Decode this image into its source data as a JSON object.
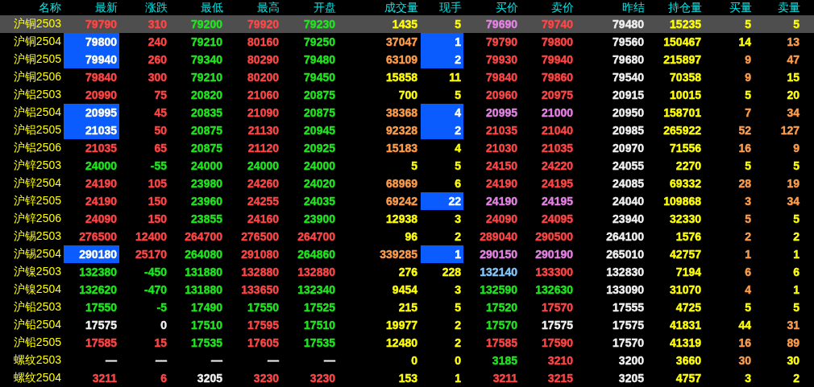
{
  "columns": [
    "名称",
    "最新",
    "涨跌",
    "最低",
    "最高",
    "开盘",
    "成交量",
    "现手",
    "买价",
    "卖价",
    "昨结",
    "持仓量",
    "买量",
    "卖量"
  ],
  "rows": [
    {
      "name": "沪铜2503",
      "selected": true,
      "cells": [
        {
          "text": "79790",
          "color": "#ff4646",
          "flash": false
        },
        {
          "text": "310",
          "color": "#ff4646",
          "flash": false
        },
        {
          "text": "79200",
          "color": "#1ee61e",
          "flash": false
        },
        {
          "text": "79920",
          "color": "#ff4646",
          "flash": false
        },
        {
          "text": "79230",
          "color": "#1ee61e",
          "flash": false
        },
        {
          "text": "1435",
          "color": "#ffff00",
          "flash": false
        },
        {
          "text": "5",
          "color": "#ffff00",
          "flash": false
        },
        {
          "text": "79690",
          "color": "#e682e6",
          "flash": false
        },
        {
          "text": "79740",
          "color": "#ff4646",
          "flash": false
        },
        {
          "text": "79480",
          "color": "#f0f0f0",
          "flash": false
        },
        {
          "text": "15235",
          "color": "#ffff00",
          "flash": false
        },
        {
          "text": "5",
          "color": "#ffff00",
          "flash": false
        },
        {
          "text": "5",
          "color": "#ffff00",
          "flash": false
        }
      ]
    },
    {
      "name": "沪铜2504",
      "selected": false,
      "cells": [
        {
          "text": "79800",
          "color": "#ffffff",
          "flash": true
        },
        {
          "text": "240",
          "color": "#ff4646",
          "flash": false
        },
        {
          "text": "79210",
          "color": "#1ee61e",
          "flash": false
        },
        {
          "text": "80160",
          "color": "#ff4646",
          "flash": false
        },
        {
          "text": "79250",
          "color": "#1ee61e",
          "flash": false
        },
        {
          "text": "37047",
          "color": "#ff9c4a",
          "flash": false
        },
        {
          "text": "1",
          "color": "#ffffff",
          "flash": true
        },
        {
          "text": "79790",
          "color": "#ff4646",
          "flash": false
        },
        {
          "text": "79800",
          "color": "#ff4646",
          "flash": false
        },
        {
          "text": "79560",
          "color": "#f0f0f0",
          "flash": false
        },
        {
          "text": "150467",
          "color": "#ffff00",
          "flash": false
        },
        {
          "text": "14",
          "color": "#ffff00",
          "flash": false
        },
        {
          "text": "13",
          "color": "#ff9c4a",
          "flash": false
        }
      ]
    },
    {
      "name": "沪铜2505",
      "selected": false,
      "cells": [
        {
          "text": "79940",
          "color": "#ffffff",
          "flash": true
        },
        {
          "text": "260",
          "color": "#ff4646",
          "flash": false
        },
        {
          "text": "79340",
          "color": "#1ee61e",
          "flash": false
        },
        {
          "text": "80290",
          "color": "#ff4646",
          "flash": false
        },
        {
          "text": "79480",
          "color": "#1ee61e",
          "flash": false
        },
        {
          "text": "63109",
          "color": "#ff9c4a",
          "flash": false
        },
        {
          "text": "2",
          "color": "#ffffff",
          "flash": true
        },
        {
          "text": "79930",
          "color": "#ff4646",
          "flash": false
        },
        {
          "text": "79940",
          "color": "#ff4646",
          "flash": false
        },
        {
          "text": "79680",
          "color": "#f0f0f0",
          "flash": false
        },
        {
          "text": "215897",
          "color": "#ffff00",
          "flash": false
        },
        {
          "text": "9",
          "color": "#ff9c4a",
          "flash": false
        },
        {
          "text": "47",
          "color": "#ff9c4a",
          "flash": false
        }
      ]
    },
    {
      "name": "沪铜2506",
      "selected": false,
      "cells": [
        {
          "text": "79840",
          "color": "#ff4646",
          "flash": false
        },
        {
          "text": "300",
          "color": "#ff4646",
          "flash": false
        },
        {
          "text": "79210",
          "color": "#1ee61e",
          "flash": false
        },
        {
          "text": "80200",
          "color": "#ff4646",
          "flash": false
        },
        {
          "text": "79450",
          "color": "#1ee61e",
          "flash": false
        },
        {
          "text": "15858",
          "color": "#ffff00",
          "flash": false
        },
        {
          "text": "11",
          "color": "#ffff00",
          "flash": false
        },
        {
          "text": "79840",
          "color": "#ff4646",
          "flash": false
        },
        {
          "text": "79860",
          "color": "#ff4646",
          "flash": false
        },
        {
          "text": "79540",
          "color": "#f0f0f0",
          "flash": false
        },
        {
          "text": "70358",
          "color": "#ffff00",
          "flash": false
        },
        {
          "text": "9",
          "color": "#ff9c4a",
          "flash": false
        },
        {
          "text": "15",
          "color": "#ffff00",
          "flash": false
        }
      ]
    },
    {
      "name": "沪铝2503",
      "selected": false,
      "cells": [
        {
          "text": "20990",
          "color": "#ff4646",
          "flash": false
        },
        {
          "text": "75",
          "color": "#ff4646",
          "flash": false
        },
        {
          "text": "20820",
          "color": "#1ee61e",
          "flash": false
        },
        {
          "text": "21060",
          "color": "#ff4646",
          "flash": false
        },
        {
          "text": "20875",
          "color": "#1ee61e",
          "flash": false
        },
        {
          "text": "700",
          "color": "#ffff00",
          "flash": false
        },
        {
          "text": "5",
          "color": "#ffff00",
          "flash": false
        },
        {
          "text": "20960",
          "color": "#ff4646",
          "flash": false
        },
        {
          "text": "20975",
          "color": "#ff4646",
          "flash": false
        },
        {
          "text": "20915",
          "color": "#f0f0f0",
          "flash": false
        },
        {
          "text": "10015",
          "color": "#ffff00",
          "flash": false
        },
        {
          "text": "5",
          "color": "#ffff00",
          "flash": false
        },
        {
          "text": "20",
          "color": "#ffff00",
          "flash": false
        }
      ]
    },
    {
      "name": "沪铝2504",
      "selected": false,
      "cells": [
        {
          "text": "20995",
          "color": "#ffffff",
          "flash": true
        },
        {
          "text": "45",
          "color": "#ff4646",
          "flash": false
        },
        {
          "text": "20835",
          "color": "#1ee61e",
          "flash": false
        },
        {
          "text": "21090",
          "color": "#ff4646",
          "flash": false
        },
        {
          "text": "20875",
          "color": "#1ee61e",
          "flash": false
        },
        {
          "text": "38368",
          "color": "#ff9c4a",
          "flash": false
        },
        {
          "text": "4",
          "color": "#ffffff",
          "flash": true
        },
        {
          "text": "20995",
          "color": "#e682e6",
          "flash": false
        },
        {
          "text": "21000",
          "color": "#e682e6",
          "flash": false
        },
        {
          "text": "20950",
          "color": "#f0f0f0",
          "flash": false
        },
        {
          "text": "158701",
          "color": "#ffff00",
          "flash": false
        },
        {
          "text": "7",
          "color": "#ff9c4a",
          "flash": false
        },
        {
          "text": "34",
          "color": "#ff9c4a",
          "flash": false
        }
      ]
    },
    {
      "name": "沪铝2505",
      "selected": false,
      "cells": [
        {
          "text": "21035",
          "color": "#ffffff",
          "flash": true
        },
        {
          "text": "50",
          "color": "#ff4646",
          "flash": false
        },
        {
          "text": "20875",
          "color": "#1ee61e",
          "flash": false
        },
        {
          "text": "21130",
          "color": "#ff4646",
          "flash": false
        },
        {
          "text": "20945",
          "color": "#1ee61e",
          "flash": false
        },
        {
          "text": "92328",
          "color": "#ff9c4a",
          "flash": false
        },
        {
          "text": "2",
          "color": "#ffffff",
          "flash": true
        },
        {
          "text": "21035",
          "color": "#ff4646",
          "flash": false
        },
        {
          "text": "21040",
          "color": "#ff4646",
          "flash": false
        },
        {
          "text": "20985",
          "color": "#f0f0f0",
          "flash": false
        },
        {
          "text": "265922",
          "color": "#ffff00",
          "flash": false
        },
        {
          "text": "52",
          "color": "#ff9c4a",
          "flash": false
        },
        {
          "text": "127",
          "color": "#ff9c4a",
          "flash": false
        }
      ]
    },
    {
      "name": "沪铝2506",
      "selected": false,
      "cells": [
        {
          "text": "21035",
          "color": "#ff4646",
          "flash": false
        },
        {
          "text": "65",
          "color": "#ff4646",
          "flash": false
        },
        {
          "text": "20875",
          "color": "#1ee61e",
          "flash": false
        },
        {
          "text": "21120",
          "color": "#ff4646",
          "flash": false
        },
        {
          "text": "20925",
          "color": "#1ee61e",
          "flash": false
        },
        {
          "text": "15183",
          "color": "#ff9c4a",
          "flash": false
        },
        {
          "text": "4",
          "color": "#ffff00",
          "flash": false
        },
        {
          "text": "21030",
          "color": "#ff4646",
          "flash": false
        },
        {
          "text": "21035",
          "color": "#ff4646",
          "flash": false
        },
        {
          "text": "20970",
          "color": "#f0f0f0",
          "flash": false
        },
        {
          "text": "71556",
          "color": "#ffff00",
          "flash": false
        },
        {
          "text": "16",
          "color": "#ff9c4a",
          "flash": false
        },
        {
          "text": "9",
          "color": "#ff9c4a",
          "flash": false
        }
      ]
    },
    {
      "name": "沪锌2503",
      "selected": false,
      "cells": [
        {
          "text": "24000",
          "color": "#1ee61e",
          "flash": false
        },
        {
          "text": "-55",
          "color": "#1ee61e",
          "flash": false
        },
        {
          "text": "24000",
          "color": "#1ee61e",
          "flash": false
        },
        {
          "text": "24000",
          "color": "#1ee61e",
          "flash": false
        },
        {
          "text": "24000",
          "color": "#1ee61e",
          "flash": false
        },
        {
          "text": "5",
          "color": "#ffff00",
          "flash": false
        },
        {
          "text": "5",
          "color": "#ffff00",
          "flash": false
        },
        {
          "text": "24150",
          "color": "#ff4646",
          "flash": false
        },
        {
          "text": "24220",
          "color": "#ff4646",
          "flash": false
        },
        {
          "text": "24055",
          "color": "#f0f0f0",
          "flash": false
        },
        {
          "text": "2270",
          "color": "#ffff00",
          "flash": false
        },
        {
          "text": "5",
          "color": "#ffff00",
          "flash": false
        },
        {
          "text": "5",
          "color": "#ffff00",
          "flash": false
        }
      ]
    },
    {
      "name": "沪锌2504",
      "selected": false,
      "cells": [
        {
          "text": "24190",
          "color": "#ff4646",
          "flash": false
        },
        {
          "text": "105",
          "color": "#ff4646",
          "flash": false
        },
        {
          "text": "23980",
          "color": "#1ee61e",
          "flash": false
        },
        {
          "text": "24260",
          "color": "#ff4646",
          "flash": false
        },
        {
          "text": "24020",
          "color": "#1ee61e",
          "flash": false
        },
        {
          "text": "68969",
          "color": "#ff9c4a",
          "flash": false
        },
        {
          "text": "6",
          "color": "#ffff00",
          "flash": false
        },
        {
          "text": "24190",
          "color": "#ff4646",
          "flash": false
        },
        {
          "text": "24195",
          "color": "#ff4646",
          "flash": false
        },
        {
          "text": "24085",
          "color": "#f0f0f0",
          "flash": false
        },
        {
          "text": "69332",
          "color": "#ffff00",
          "flash": false
        },
        {
          "text": "28",
          "color": "#ff9c4a",
          "flash": false
        },
        {
          "text": "19",
          "color": "#ff9c4a",
          "flash": false
        }
      ]
    },
    {
      "name": "沪锌2505",
      "selected": false,
      "cells": [
        {
          "text": "24190",
          "color": "#ff4646",
          "flash": false
        },
        {
          "text": "150",
          "color": "#ff4646",
          "flash": false
        },
        {
          "text": "23960",
          "color": "#1ee61e",
          "flash": false
        },
        {
          "text": "24255",
          "color": "#ff4646",
          "flash": false
        },
        {
          "text": "24035",
          "color": "#1ee61e",
          "flash": false
        },
        {
          "text": "69242",
          "color": "#ff9c4a",
          "flash": false
        },
        {
          "text": "22",
          "color": "#ffffff",
          "flash": true
        },
        {
          "text": "24190",
          "color": "#e682e6",
          "flash": false
        },
        {
          "text": "24195",
          "color": "#e682e6",
          "flash": false
        },
        {
          "text": "24040",
          "color": "#f0f0f0",
          "flash": false
        },
        {
          "text": "109868",
          "color": "#ffff00",
          "flash": false
        },
        {
          "text": "3",
          "color": "#ff9c4a",
          "flash": false
        },
        {
          "text": "34",
          "color": "#ff9c4a",
          "flash": false
        }
      ]
    },
    {
      "name": "沪锌2506",
      "selected": false,
      "cells": [
        {
          "text": "24090",
          "color": "#ff4646",
          "flash": false
        },
        {
          "text": "150",
          "color": "#ff4646",
          "flash": false
        },
        {
          "text": "23855",
          "color": "#1ee61e",
          "flash": false
        },
        {
          "text": "24160",
          "color": "#ff4646",
          "flash": false
        },
        {
          "text": "23900",
          "color": "#1ee61e",
          "flash": false
        },
        {
          "text": "12938",
          "color": "#ffff00",
          "flash": false
        },
        {
          "text": "3",
          "color": "#ffff00",
          "flash": false
        },
        {
          "text": "24090",
          "color": "#ff4646",
          "flash": false
        },
        {
          "text": "24095",
          "color": "#ff4646",
          "flash": false
        },
        {
          "text": "23940",
          "color": "#f0f0f0",
          "flash": false
        },
        {
          "text": "32330",
          "color": "#ffff00",
          "flash": false
        },
        {
          "text": "5",
          "color": "#ff9c4a",
          "flash": false
        },
        {
          "text": "5",
          "color": "#ffff00",
          "flash": false
        }
      ]
    },
    {
      "name": "沪锡2503",
      "selected": false,
      "cells": [
        {
          "text": "276500",
          "color": "#ff4646",
          "flash": false
        },
        {
          "text": "12400",
          "color": "#ff4646",
          "flash": false
        },
        {
          "text": "264700",
          "color": "#ff4646",
          "flash": false
        },
        {
          "text": "276500",
          "color": "#ff4646",
          "flash": false
        },
        {
          "text": "264700",
          "color": "#ff4646",
          "flash": false
        },
        {
          "text": "96",
          "color": "#ffff00",
          "flash": false
        },
        {
          "text": "2",
          "color": "#ffff00",
          "flash": false
        },
        {
          "text": "289040",
          "color": "#ff4646",
          "flash": false
        },
        {
          "text": "290500",
          "color": "#ff4646",
          "flash": false
        },
        {
          "text": "264100",
          "color": "#f0f0f0",
          "flash": false
        },
        {
          "text": "1576",
          "color": "#ffff00",
          "flash": false
        },
        {
          "text": "2",
          "color": "#ff9c4a",
          "flash": false
        },
        {
          "text": "2",
          "color": "#ffff00",
          "flash": false
        }
      ]
    },
    {
      "name": "沪锡2504",
      "selected": false,
      "cells": [
        {
          "text": "290180",
          "color": "#ffffff",
          "flash": true
        },
        {
          "text": "25170",
          "color": "#ff4646",
          "flash": false
        },
        {
          "text": "264080",
          "color": "#1ee61e",
          "flash": false
        },
        {
          "text": "291080",
          "color": "#ff4646",
          "flash": false
        },
        {
          "text": "264860",
          "color": "#1ee61e",
          "flash": false
        },
        {
          "text": "339285",
          "color": "#ff9c4a",
          "flash": false
        },
        {
          "text": "1",
          "color": "#ffffff",
          "flash": true
        },
        {
          "text": "290150",
          "color": "#e682e6",
          "flash": false
        },
        {
          "text": "290190",
          "color": "#e682e6",
          "flash": false
        },
        {
          "text": "265010",
          "color": "#f0f0f0",
          "flash": false
        },
        {
          "text": "42757",
          "color": "#ffff00",
          "flash": false
        },
        {
          "text": "1",
          "color": "#ff9c4a",
          "flash": false
        },
        {
          "text": "1",
          "color": "#ffff00",
          "flash": false
        }
      ]
    },
    {
      "name": "沪镍2503",
      "selected": false,
      "cells": [
        {
          "text": "132380",
          "color": "#1ee61e",
          "flash": false
        },
        {
          "text": "-450",
          "color": "#1ee61e",
          "flash": false
        },
        {
          "text": "131880",
          "color": "#1ee61e",
          "flash": false
        },
        {
          "text": "132880",
          "color": "#ff4646",
          "flash": false
        },
        {
          "text": "132880",
          "color": "#ff4646",
          "flash": false
        },
        {
          "text": "276",
          "color": "#ffff00",
          "flash": false
        },
        {
          "text": "228",
          "color": "#ffff00",
          "flash": false
        },
        {
          "text": "132140",
          "color": "#80c8ff",
          "flash": false
        },
        {
          "text": "133300",
          "color": "#ff4646",
          "flash": false
        },
        {
          "text": "132830",
          "color": "#f0f0f0",
          "flash": false
        },
        {
          "text": "7194",
          "color": "#ffff00",
          "flash": false
        },
        {
          "text": "6",
          "color": "#ff9c4a",
          "flash": false
        },
        {
          "text": "6",
          "color": "#ffff00",
          "flash": false
        }
      ]
    },
    {
      "name": "沪镍2504",
      "selected": false,
      "cells": [
        {
          "text": "132620",
          "color": "#1ee61e",
          "flash": false
        },
        {
          "text": "-470",
          "color": "#1ee61e",
          "flash": false
        },
        {
          "text": "131880",
          "color": "#1ee61e",
          "flash": false
        },
        {
          "text": "133650",
          "color": "#ff4646",
          "flash": false
        },
        {
          "text": "132340",
          "color": "#1ee61e",
          "flash": false
        },
        {
          "text": "9454",
          "color": "#ffff00",
          "flash": false
        },
        {
          "text": "3",
          "color": "#ffff00",
          "flash": false
        },
        {
          "text": "132590",
          "color": "#1ee61e",
          "flash": false
        },
        {
          "text": "132630",
          "color": "#1ee61e",
          "flash": false
        },
        {
          "text": "133090",
          "color": "#f0f0f0",
          "flash": false
        },
        {
          "text": "31070",
          "color": "#ffff00",
          "flash": false
        },
        {
          "text": "4",
          "color": "#ff9c4a",
          "flash": false
        },
        {
          "text": "1",
          "color": "#ffff00",
          "flash": false
        }
      ]
    },
    {
      "name": "沪铅2503",
      "selected": false,
      "cells": [
        {
          "text": "17550",
          "color": "#1ee61e",
          "flash": false
        },
        {
          "text": "-5",
          "color": "#1ee61e",
          "flash": false
        },
        {
          "text": "17490",
          "color": "#1ee61e",
          "flash": false
        },
        {
          "text": "17550",
          "color": "#1ee61e",
          "flash": false
        },
        {
          "text": "17525",
          "color": "#1ee61e",
          "flash": false
        },
        {
          "text": "215",
          "color": "#ffff00",
          "flash": false
        },
        {
          "text": "5",
          "color": "#ffff00",
          "flash": false
        },
        {
          "text": "17520",
          "color": "#1ee61e",
          "flash": false
        },
        {
          "text": "17570",
          "color": "#ff4646",
          "flash": false
        },
        {
          "text": "17555",
          "color": "#f0f0f0",
          "flash": false
        },
        {
          "text": "4725",
          "color": "#ffff00",
          "flash": false
        },
        {
          "text": "5",
          "color": "#ffff00",
          "flash": false
        },
        {
          "text": "5",
          "color": "#ffff00",
          "flash": false
        }
      ]
    },
    {
      "name": "沪铅2504",
      "selected": false,
      "cells": [
        {
          "text": "17575",
          "color": "#f0f0f0",
          "flash": false
        },
        {
          "text": "0",
          "color": "#f0f0f0",
          "flash": false
        },
        {
          "text": "17510",
          "color": "#1ee61e",
          "flash": false
        },
        {
          "text": "17595",
          "color": "#ff4646",
          "flash": false
        },
        {
          "text": "17510",
          "color": "#1ee61e",
          "flash": false
        },
        {
          "text": "19977",
          "color": "#ffff00",
          "flash": false
        },
        {
          "text": "2",
          "color": "#ffff00",
          "flash": false
        },
        {
          "text": "17570",
          "color": "#1ee61e",
          "flash": false
        },
        {
          "text": "17575",
          "color": "#f0f0f0",
          "flash": false
        },
        {
          "text": "17575",
          "color": "#f0f0f0",
          "flash": false
        },
        {
          "text": "41831",
          "color": "#ffff00",
          "flash": false
        },
        {
          "text": "44",
          "color": "#ffff00",
          "flash": false
        },
        {
          "text": "31",
          "color": "#ff9c4a",
          "flash": false
        }
      ]
    },
    {
      "name": "沪铅2505",
      "selected": false,
      "cells": [
        {
          "text": "17585",
          "color": "#ff4646",
          "flash": false
        },
        {
          "text": "15",
          "color": "#ff4646",
          "flash": false
        },
        {
          "text": "17535",
          "color": "#1ee61e",
          "flash": false
        },
        {
          "text": "17605",
          "color": "#ff4646",
          "flash": false
        },
        {
          "text": "17535",
          "color": "#1ee61e",
          "flash": false
        },
        {
          "text": "12480",
          "color": "#ffff00",
          "flash": false
        },
        {
          "text": "2",
          "color": "#ffff00",
          "flash": false
        },
        {
          "text": "17585",
          "color": "#ff4646",
          "flash": false
        },
        {
          "text": "17590",
          "color": "#ff4646",
          "flash": false
        },
        {
          "text": "17570",
          "color": "#f0f0f0",
          "flash": false
        },
        {
          "text": "41319",
          "color": "#ffff00",
          "flash": false
        },
        {
          "text": "16",
          "color": "#ff9c4a",
          "flash": false
        },
        {
          "text": "89",
          "color": "#ff9c4a",
          "flash": false
        }
      ]
    },
    {
      "name": "螺纹2503",
      "selected": false,
      "cells": [
        {
          "text": "—",
          "color": "#f0f0f0",
          "flash": false
        },
        {
          "text": "—",
          "color": "#f0f0f0",
          "flash": false
        },
        {
          "text": "—",
          "color": "#f0f0f0",
          "flash": false
        },
        {
          "text": "—",
          "color": "#f0f0f0",
          "flash": false
        },
        {
          "text": "—",
          "color": "#f0f0f0",
          "flash": false
        },
        {
          "text": "0",
          "color": "#ffff00",
          "flash": false
        },
        {
          "text": "0",
          "color": "#ffff00",
          "flash": false
        },
        {
          "text": "3185",
          "color": "#1ee61e",
          "flash": false
        },
        {
          "text": "3210",
          "color": "#ff4646",
          "flash": false
        },
        {
          "text": "3200",
          "color": "#f0f0f0",
          "flash": false
        },
        {
          "text": "3660",
          "color": "#ffff00",
          "flash": false
        },
        {
          "text": "30",
          "color": "#ff9c4a",
          "flash": false
        },
        {
          "text": "30",
          "color": "#ffff00",
          "flash": false
        }
      ]
    },
    {
      "name": "螺纹2504",
      "selected": false,
      "cells": [
        {
          "text": "3211",
          "color": "#ff4646",
          "flash": false
        },
        {
          "text": "6",
          "color": "#ff4646",
          "flash": false
        },
        {
          "text": "3205",
          "color": "#f0f0f0",
          "flash": false
        },
        {
          "text": "3230",
          "color": "#ff4646",
          "flash": false
        },
        {
          "text": "3230",
          "color": "#ff4646",
          "flash": false
        },
        {
          "text": "153",
          "color": "#ffff00",
          "flash": false
        },
        {
          "text": "1",
          "color": "#ffff00",
          "flash": false
        },
        {
          "text": "3211",
          "color": "#ff4646",
          "flash": false
        },
        {
          "text": "3215",
          "color": "#ff4646",
          "flash": false
        },
        {
          "text": "3205",
          "color": "#f0f0f0",
          "flash": false
        },
        {
          "text": "4757",
          "color": "#ffff00",
          "flash": false
        },
        {
          "text": "3",
          "color": "#ffff00",
          "flash": false
        },
        {
          "text": "2",
          "color": "#ffff00",
          "flash": false
        }
      ]
    }
  ]
}
